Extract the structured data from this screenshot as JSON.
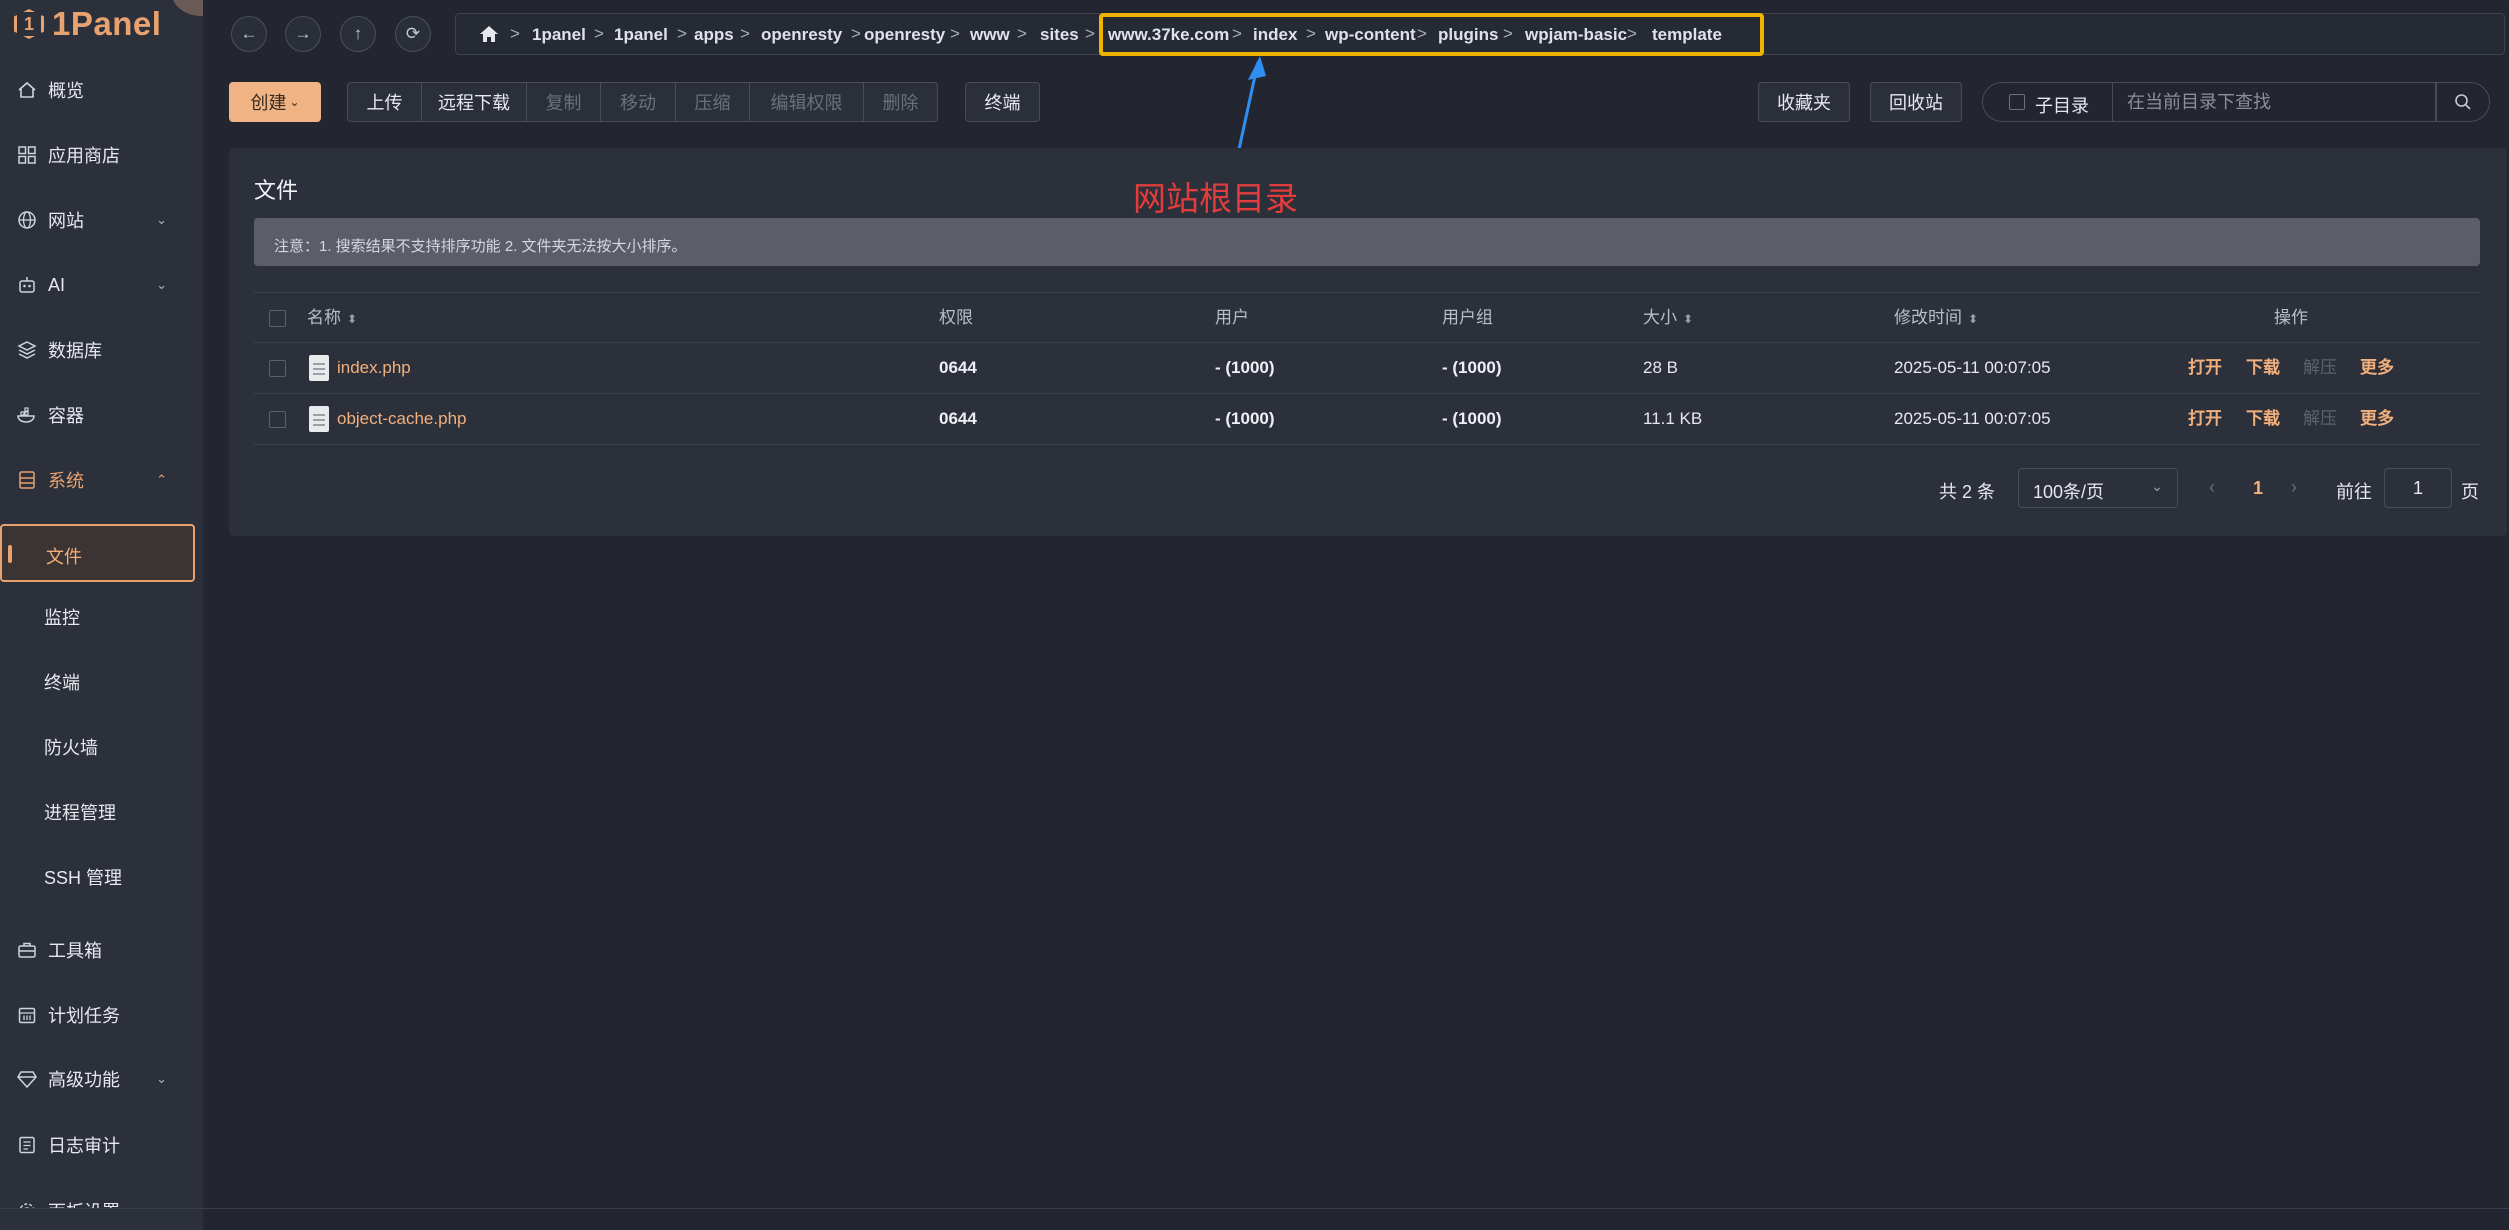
{
  "logo": {
    "text": "1Panel",
    "color": "#e8a270"
  },
  "sidebar": {
    "items": [
      {
        "label": "概览",
        "icon": "home-icon",
        "chevron": ""
      },
      {
        "label": "应用商店",
        "icon": "grid-icon",
        "chevron": ""
      },
      {
        "label": "网站",
        "icon": "globe-icon",
        "chevron": "⌄"
      },
      {
        "label": "AI",
        "icon": "robot-icon",
        "chevron": "⌄"
      },
      {
        "label": "数据库",
        "icon": "layers-icon",
        "chevron": ""
      },
      {
        "label": "容器",
        "icon": "container-icon",
        "chevron": ""
      },
      {
        "label": "系统",
        "icon": "server-icon",
        "chevron": "⌃"
      },
      {
        "label": "文件",
        "icon": "",
        "chevron": ""
      },
      {
        "label": "监控",
        "icon": "",
        "chevron": ""
      },
      {
        "label": "终端",
        "icon": "",
        "chevron": ""
      },
      {
        "label": "防火墙",
        "icon": "",
        "chevron": ""
      },
      {
        "label": "进程管理",
        "icon": "",
        "chevron": ""
      },
      {
        "label": "SSH 管理",
        "icon": "",
        "chevron": ""
      },
      {
        "label": "工具箱",
        "icon": "toolbox-icon",
        "chevron": ""
      },
      {
        "label": "计划任务",
        "icon": "calendar-icon",
        "chevron": ""
      },
      {
        "label": "高级功能",
        "icon": "diamond-icon",
        "chevron": "⌄"
      },
      {
        "label": "日志审计",
        "icon": "log-icon",
        "chevron": ""
      },
      {
        "label": "面板设置",
        "icon": "settings-icon",
        "chevron": ""
      }
    ]
  },
  "breadcrumb": [
    "1panel",
    "1panel",
    "apps",
    "openresty",
    "openresty",
    "www",
    "sites",
    "www.37ke.com",
    "index",
    "wp-content",
    "plugins",
    "wpjam-basic",
    "template"
  ],
  "breadcrumb_sep": ">",
  "toolbar": {
    "create": "创建",
    "upload": "上传",
    "remote_download": "远程下载",
    "copy": "复制",
    "move": "移动",
    "compress": "压缩",
    "edit_permission": "编辑权限",
    "delete": "删除",
    "terminal": "终端",
    "favorites": "收藏夹",
    "recycle_bin": "回收站",
    "subdir": "子目录",
    "search_placeholder": "在当前目录下查找"
  },
  "panel": {
    "title": "文件",
    "notice": "注意：1. 搜索结果不支持排序功能 2. 文件夹无法按大小排序。"
  },
  "table": {
    "headers": {
      "name": "名称",
      "perm": "权限",
      "user": "用户",
      "group": "用户组",
      "size": "大小",
      "mtime": "修改时间",
      "ops": "操作"
    },
    "rows": [
      {
        "name": "index.php",
        "perm": "0644",
        "user": "- (1000)",
        "group": "- (1000)",
        "size": "28 B",
        "mtime": "2025-05-11 00:07:05"
      },
      {
        "name": "object-cache.php",
        "perm": "0644",
        "user": "- (1000)",
        "group": "- (1000)",
        "size": "11.1 KB",
        "mtime": "2025-05-11 00:07:05"
      }
    ],
    "ops": {
      "open": "打开",
      "download": "下载",
      "extract": "解压",
      "more": "更多"
    }
  },
  "pagination": {
    "total": "共 2 条",
    "page_size": "100条/页",
    "current": "1",
    "goto": "前往",
    "goto_value": "1",
    "page_unit": "页"
  },
  "annotation": {
    "text": "网站根目录",
    "color": "#e23c3c",
    "box_color": "#f0b400",
    "arrow_color": "#2f8ff0"
  },
  "colors": {
    "accent": "#f2b07c",
    "background": "#232630",
    "sidebar": "#2c303b"
  }
}
